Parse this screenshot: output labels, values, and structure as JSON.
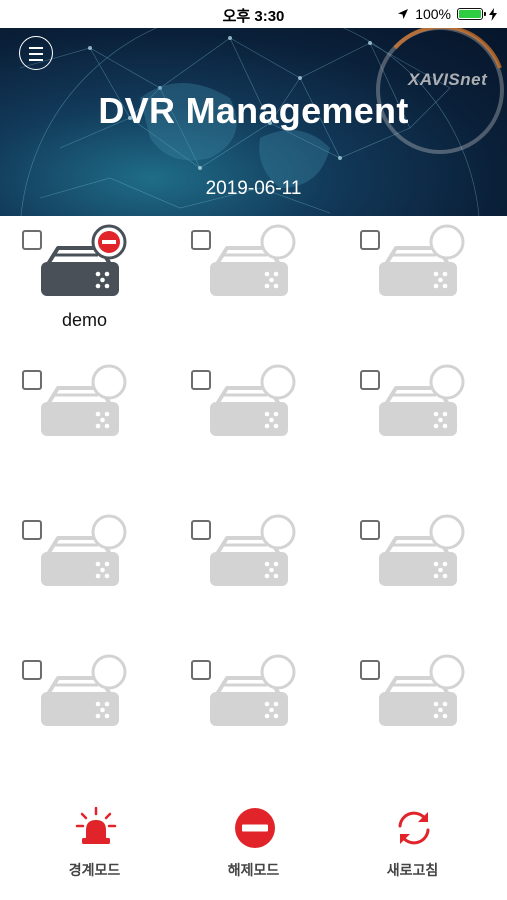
{
  "status_bar": {
    "time": "오후 3:30",
    "battery": "100%"
  },
  "header": {
    "title": "DVR Management",
    "date": "2019-06-11",
    "brand": "XAVISnet"
  },
  "devices": [
    {
      "label": "demo",
      "state": "active"
    },
    {
      "label": "",
      "state": "empty"
    },
    {
      "label": "",
      "state": "empty"
    },
    {
      "label": "",
      "state": "empty"
    },
    {
      "label": "",
      "state": "empty"
    },
    {
      "label": "",
      "state": "empty"
    },
    {
      "label": "",
      "state": "empty"
    },
    {
      "label": "",
      "state": "empty"
    },
    {
      "label": "",
      "state": "empty"
    },
    {
      "label": "",
      "state": "empty"
    },
    {
      "label": "",
      "state": "empty"
    },
    {
      "label": "",
      "state": "empty"
    }
  ],
  "bottom_bar": {
    "alarm_mode": "경계모드",
    "disarm_mode": "해제모드",
    "refresh": "새로고침"
  },
  "colors": {
    "accent_red": "#e0242a",
    "active_dvr": "#4a5058",
    "inactive_dvr": "#d3d3d3"
  }
}
